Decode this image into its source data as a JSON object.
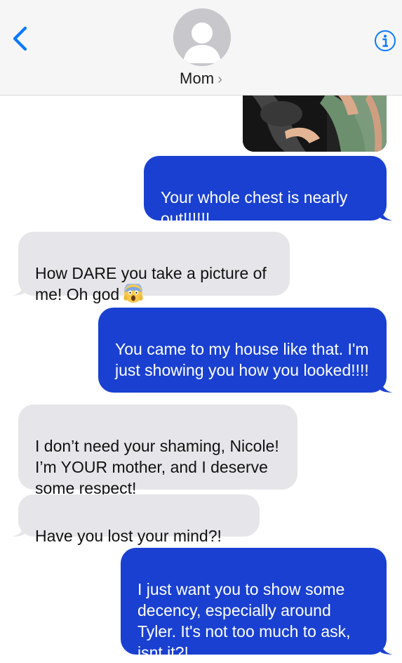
{
  "header": {
    "contact_name": "Mom",
    "chevron": "›",
    "back_icon": "chevron-left-icon",
    "info_icon": "info-icon",
    "accent_color": "#0a7aff"
  },
  "messages": [
    {
      "direction": "sent",
      "text": "Your whole chest is nearly out!!!!!!"
    },
    {
      "direction": "received",
      "text": "How DARE you take a picture of me! Oh god",
      "emoji": "face-screaming-in-fear"
    },
    {
      "direction": "sent",
      "text": "You came to my house like that. I'm just showing you how you looked!!!!"
    },
    {
      "direction": "received",
      "text": "I don’t need your shaming, Nicole! I’m YOUR mother, and I deserve some respect!"
    },
    {
      "direction": "received",
      "text": "Have you lost your mind?!"
    },
    {
      "direction": "sent",
      "text": "I just want you to show some decency, especially around Tyler. It's not too much to ask, isnt it?!"
    }
  ],
  "colors": {
    "sent_bubble": "#1940d1",
    "received_bubble": "#e6e6ea",
    "header_bg": "#f6f6f6"
  }
}
